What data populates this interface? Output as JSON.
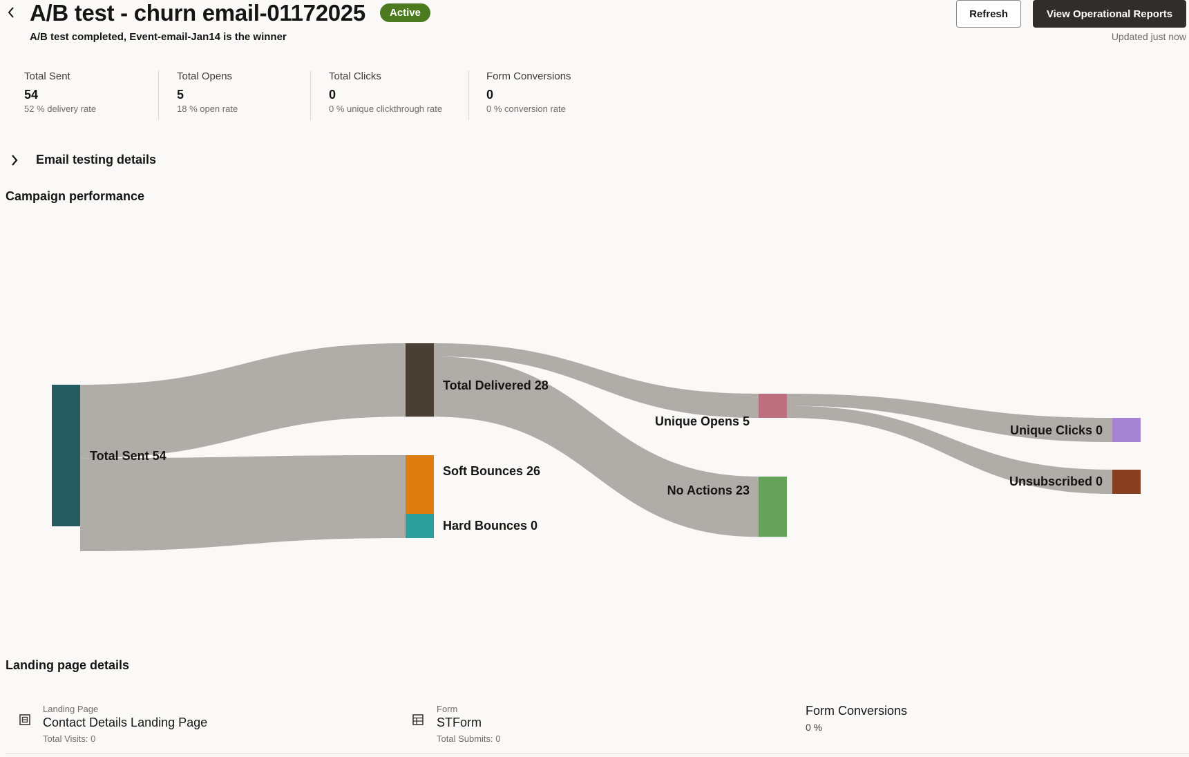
{
  "header": {
    "title": "A/B test - churn email-01172025",
    "status": "Active",
    "subtitle": "A/B test completed, Event-email-Jan14 is the winner",
    "refresh_label": "Refresh",
    "reports_label": "View Operational Reports",
    "updated": "Updated just now"
  },
  "metrics": [
    {
      "label": "Total Sent",
      "value": "54",
      "sub": "52 % delivery rate"
    },
    {
      "label": "Total Opens",
      "value": "5",
      "sub": "18 % open rate"
    },
    {
      "label": "Total Clicks",
      "value": "0",
      "sub": "0 % unique clickthrough rate"
    },
    {
      "label": "Form Conversions",
      "value": "0",
      "sub": "0 % conversion rate"
    }
  ],
  "email_testing": {
    "label": "Email testing details"
  },
  "campaign": {
    "heading": "Campaign performance"
  },
  "sankey": {
    "nodes": [
      {
        "id": "sent",
        "label": "Total Sent 54",
        "value": 54,
        "color": "#245a60"
      },
      {
        "id": "delivered",
        "label": "Total Delivered 28",
        "value": 28,
        "color": "#4a3f35"
      },
      {
        "id": "soft",
        "label": "Soft Bounces 26",
        "value": 26,
        "color": "#e07d10"
      },
      {
        "id": "hard",
        "label": "Hard Bounces 0",
        "value": 0,
        "color": "#2d9f9a"
      },
      {
        "id": "opens",
        "label": "Unique Opens 5",
        "value": 5,
        "color": "#bd6f80"
      },
      {
        "id": "noact",
        "label": "No Actions 23",
        "value": 23,
        "color": "#67a25d"
      },
      {
        "id": "clicks",
        "label": "Unique Clicks 0",
        "value": 0,
        "color": "#a584d3"
      },
      {
        "id": "unsub",
        "label": "Unsubscribed 0",
        "value": 0,
        "color": "#873f1f"
      }
    ],
    "links": [
      {
        "from": "sent",
        "to": "delivered",
        "value": 28
      },
      {
        "from": "sent",
        "to": "soft",
        "value": 26
      },
      {
        "from": "sent",
        "to": "hard",
        "value": 0
      },
      {
        "from": "delivered",
        "to": "opens",
        "value": 5
      },
      {
        "from": "delivered",
        "to": "noact",
        "value": 23
      },
      {
        "from": "opens",
        "to": "clicks",
        "value": 0
      },
      {
        "from": "opens",
        "to": "unsub",
        "value": 0
      }
    ]
  },
  "landing": {
    "heading": "Landing page details",
    "page": {
      "small": "Landing Page",
      "name": "Contact Details Landing Page",
      "sub": "Total Visits: 0"
    },
    "form": {
      "small": "Form",
      "name": "STForm",
      "sub": "Total Submits: 0"
    },
    "conversions": {
      "label": "Form Conversions",
      "value": "0 %"
    }
  }
}
